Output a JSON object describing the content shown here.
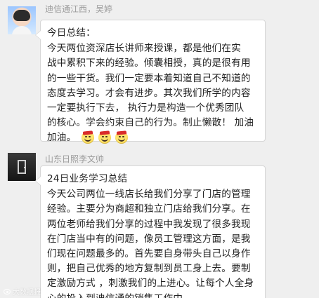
{
  "messages": [
    {
      "sender": "迪信通江西，吴婷",
      "title": "今日总结：",
      "lines": [
        " 今天两位资深店长讲师来授课，都是他们在实",
        "战中累积下来的经验。倾囊相授，真的是很有用",
        "的一些干货。我们一定要本着知道自己不知道的",
        "态度去学习。才会有进步。其次我们所学的内容",
        "一定要执行下去，  执行力是构造一个优秀团队",
        "的核心。学会约束自己的行为。制止懒散！ 加油",
        "加油。"
      ],
      "emojis": [
        "celebration-face-emoji",
        "celebration-face-emoji",
        "celebration-face-emoji"
      ]
    },
    {
      "sender": "山东日照李文帅",
      "title": "24日业务学习总结",
      "lines": [
        "今天公司两位一线店长给我们分享了门店的管理",
        "经验。主要分为商超和独立门店给我们分享。在",
        "两位老师给我们分享的过程中我发现了很多我现",
        "在门店当中有的问题，像员工管理这方面，是我",
        "们现在问题最多的。首先要自身带头自己以身作",
        "则，把自己优秀的地方复制到员工身上去。要制",
        "定激励方式 ，刺激我们的上进心。让每个人全身",
        "心的投入到迪信通的销售工作中"
      ]
    }
  ],
  "watermark": "大数据报"
}
